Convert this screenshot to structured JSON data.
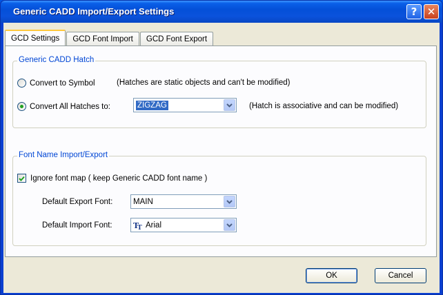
{
  "window": {
    "title": "Generic CADD Import/Export Settings",
    "help_label": "?",
    "close_label": "✕"
  },
  "tabs": [
    {
      "label": "GCD Settings",
      "active": true
    },
    {
      "label": "GCD Font Import",
      "active": false
    },
    {
      "label": "GCD Font Export",
      "active": false
    }
  ],
  "hatch_group": {
    "legend": "Generic CADD Hatch",
    "option_symbol": {
      "label": "Convert to Symbol",
      "note": "(Hatches are static objects and can't be modified)",
      "selected": false
    },
    "option_all": {
      "label": "Convert All Hatches to:",
      "value": "ZIGZAG",
      "note": "(Hatch is associative and can be modified)",
      "selected": true
    }
  },
  "font_group": {
    "legend": "Font Name Import/Export",
    "ignore_font_map": {
      "label": "Ignore font map  ( keep Generic CADD font name )",
      "checked": true
    },
    "export_font": {
      "label": "Default Export Font:",
      "value": "MAIN"
    },
    "import_font": {
      "label": "Default Import Font:",
      "value": "Arial",
      "icon": "truetype-font-icon"
    }
  },
  "buttons": {
    "ok": "OK",
    "cancel": "Cancel"
  },
  "colors": {
    "titlebar": "#0a5fe8",
    "group_legend": "#0046d5",
    "selection": "#316ac5",
    "radio_dot": "#21a121"
  }
}
